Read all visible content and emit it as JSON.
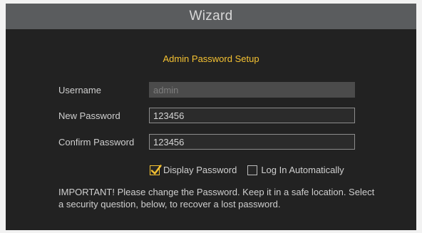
{
  "window": {
    "title": "Wizard"
  },
  "section": {
    "title": "Admin Password Setup"
  },
  "form": {
    "username": {
      "label": "Username",
      "value": "admin"
    },
    "new_password": {
      "label": "New Password",
      "value": "123456"
    },
    "confirm_password": {
      "label": "Confirm Password",
      "value": "123456"
    }
  },
  "options": {
    "display_password": {
      "label": "Display Password",
      "checked": true
    },
    "auto_login": {
      "label": "Log In Automatically",
      "checked": false
    }
  },
  "notice": "IMPORTANT! Please change the Password. Keep it in a safe location. Select a security question, below, to recover a lost password.",
  "colors": {
    "accent": "#f5c232",
    "background": "#222222",
    "titlebar": "#5a5c5e"
  },
  "icons": {
    "checked": "checkmark-icon"
  }
}
